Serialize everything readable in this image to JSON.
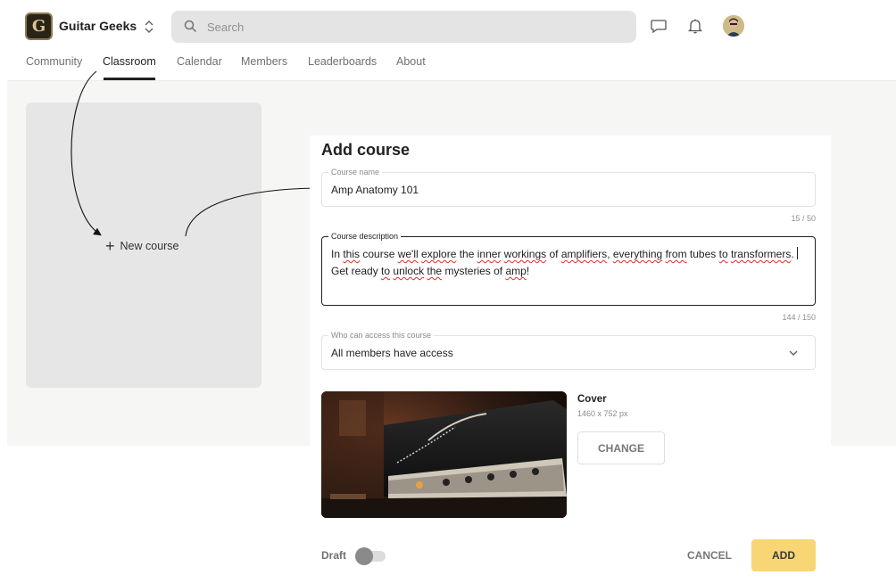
{
  "header": {
    "logo_letter": "G",
    "group_name": "Guitar Geeks",
    "search_placeholder": "Search",
    "icons": [
      "chat-icon",
      "bell-icon"
    ]
  },
  "tabs": [
    {
      "label": "Community",
      "active": false
    },
    {
      "label": "Classroom",
      "active": true
    },
    {
      "label": "Calendar",
      "active": false
    },
    {
      "label": "Members",
      "active": false
    },
    {
      "label": "Leaderboards",
      "active": false
    },
    {
      "label": "About",
      "active": false
    }
  ],
  "classroom": {
    "new_course_label": "New course"
  },
  "modal": {
    "title": "Add course",
    "course_name": {
      "label": "Course name",
      "value": "Amp Anatomy 101",
      "counter": "15 / 50"
    },
    "course_description": {
      "label": "Course description",
      "value": "In this course we'll explore the inner workings of amplifiers, everything from tubes to transformers. Get ready to unlock the mysteries of amp!",
      "counter": "144 / 150"
    },
    "access": {
      "label": "Who can access this course",
      "value": "All members have access"
    },
    "cover": {
      "title": "Cover",
      "size": "1460 x 752 px",
      "change_label": "CHANGE"
    },
    "draft_label": "Draft",
    "draft_on": false,
    "cancel_label": "CANCEL",
    "add_label": "ADD"
  },
  "colors": {
    "accent": "#f8d675",
    "text": "#202124",
    "page_bg": "#f6f6f5"
  }
}
